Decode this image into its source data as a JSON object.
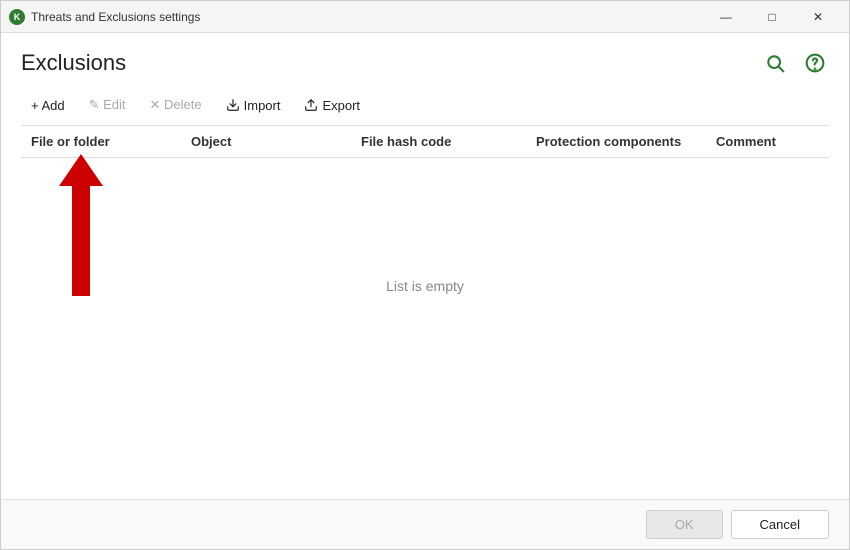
{
  "titleBar": {
    "icon": "kaspersky-icon",
    "title": "Threats and Exclusions settings",
    "minimize": "—",
    "maximize": "□",
    "close": "✕"
  },
  "page": {
    "title": "Exclusions",
    "searchIconLabel": "search",
    "helpIconLabel": "help"
  },
  "toolbar": {
    "addLabel": "+ Add",
    "editLabel": "✎ Edit",
    "deleteLabel": "✕ Delete",
    "importLabel": "Import",
    "exportLabel": "Export"
  },
  "table": {
    "columns": [
      "File or folder",
      "Object",
      "File hash code",
      "Protection components",
      "Comment"
    ],
    "emptyMessage": "List is empty",
    "rows": []
  },
  "footer": {
    "okLabel": "OK",
    "cancelLabel": "Cancel"
  }
}
